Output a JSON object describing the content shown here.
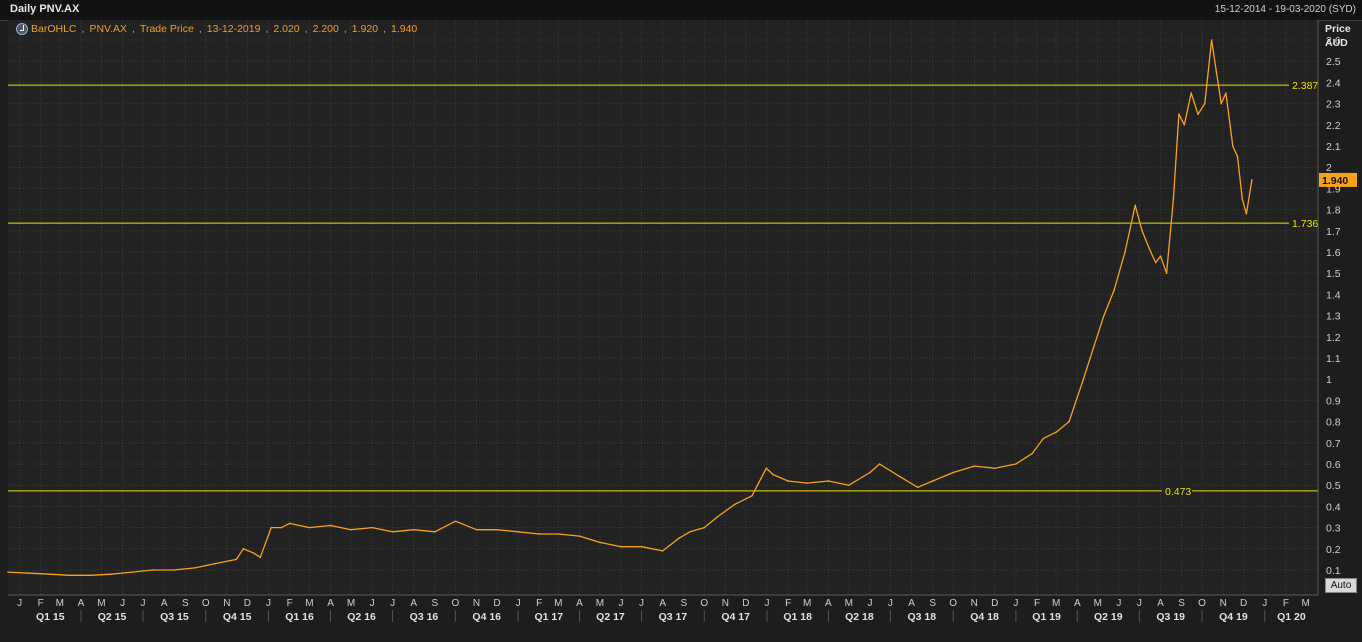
{
  "header": {
    "title": "Daily PNV.AX",
    "date_range": "15-12-2014 - 19-03-2020 (SYD)"
  },
  "legend": {
    "name": "BarOHLC",
    "ric": "PNV.AX",
    "field": "Trade Price",
    "date": "13-12-2019",
    "open": "2.020",
    "high": "2.200",
    "low": "1.920",
    "close": "1.940"
  },
  "axis": {
    "y_title": "Price",
    "y_unit": "AUD",
    "auto_label": "Auto"
  },
  "colors": {
    "background": "#1d1d1d",
    "plot_bg": "#222222",
    "grid": "#3c3c3c",
    "series": "#f7a21b",
    "hline": "#e8e000",
    "last_badge": "#f7a21b"
  },
  "chart_data": {
    "type": "line",
    "title": "Daily PNV.AX",
    "xlabel": "",
    "ylabel": "Price AUD",
    "ylim": [
      0,
      2.7
    ],
    "y_ticks": [
      "0.1",
      "0.2",
      "0.3",
      "0.4",
      "0.5",
      "0.6",
      "0.7",
      "0.8",
      "0.9",
      "1",
      "1.1",
      "1.2",
      "1.3",
      "1.4",
      "1.5",
      "1.6",
      "1.7",
      "1.8",
      "1.9",
      "2",
      "2.1",
      "2.2",
      "2.3",
      "2.4",
      "2.5",
      "2.6"
    ],
    "month_ticks": [
      "J",
      "F",
      "M",
      "A",
      "M",
      "J",
      "J",
      "A",
      "S",
      "O",
      "N",
      "D",
      "J",
      "F",
      "M",
      "A",
      "M",
      "J",
      "J",
      "A",
      "S",
      "O",
      "N",
      "D",
      "J",
      "F",
      "M",
      "A",
      "M",
      "J",
      "J",
      "A",
      "S",
      "O",
      "N",
      "D",
      "J",
      "F",
      "M",
      "A",
      "M",
      "J",
      "J",
      "A",
      "S",
      "O",
      "N",
      "D",
      "J",
      "F",
      "M",
      "A",
      "M",
      "J",
      "J",
      "A",
      "S",
      "O",
      "N",
      "D",
      "J",
      "F",
      "M"
    ],
    "quarter_ticks": [
      "Q1 15",
      "Q2 15",
      "Q3 15",
      "Q4 15",
      "Q1 16",
      "Q2 16",
      "Q3 16",
      "Q4 16",
      "Q1 17",
      "Q2 17",
      "Q3 17",
      "Q4 17",
      "Q1 18",
      "Q2 18",
      "Q3 18",
      "Q4 18",
      "Q1 19",
      "Q2 19",
      "Q3 19",
      "Q4 19",
      "Q1 20"
    ],
    "horizontal_lines": [
      {
        "value": 2.387,
        "label": "2.387"
      },
      {
        "value": 1.736,
        "label": "1.736"
      },
      {
        "value": 0.473,
        "label": "0.473"
      }
    ],
    "last_value": {
      "value": 1.94,
      "label": "1.940"
    },
    "series": [
      {
        "x": [
          "2014-12-15",
          "2015-01-15",
          "2015-02-15",
          "2015-03-15",
          "2015-04-15",
          "2015-05-15",
          "2015-06-15",
          "2015-07-15",
          "2015-08-15",
          "2015-09-15",
          "2015-10-15",
          "2015-11-15",
          "2015-11-25",
          "2015-12-10",
          "2015-12-20",
          "2016-01-05",
          "2016-01-20",
          "2016-02-01",
          "2016-03-01",
          "2016-04-01",
          "2016-05-01",
          "2016-06-01",
          "2016-07-01",
          "2016-08-01",
          "2016-09-01",
          "2016-10-01",
          "2016-11-01",
          "2016-12-01",
          "2017-01-01",
          "2017-02-01",
          "2017-03-01",
          "2017-04-01",
          "2017-05-01",
          "2017-06-01",
          "2017-07-01",
          "2017-08-01",
          "2017-08-25",
          "2017-09-10",
          "2017-10-01",
          "2017-10-20",
          "2017-11-15",
          "2017-12-10",
          "2017-12-31",
          "2018-01-10",
          "2018-02-01",
          "2018-03-01",
          "2018-04-01",
          "2018-05-01",
          "2018-06-01",
          "2018-06-15",
          "2018-07-15",
          "2018-08-10",
          "2018-09-01",
          "2018-10-01",
          "2018-11-01",
          "2018-12-01",
          "2019-01-01",
          "2019-01-25",
          "2019-02-10",
          "2019-03-01",
          "2019-03-20",
          "2019-04-10",
          "2019-04-25",
          "2019-05-10",
          "2019-05-25",
          "2019-06-10",
          "2019-06-25",
          "2019-07-05",
          "2019-07-15",
          "2019-07-25",
          "2019-08-01",
          "2019-08-10",
          "2019-08-20",
          "2019-08-28",
          "2019-09-05",
          "2019-09-15",
          "2019-09-25",
          "2019-10-05",
          "2019-10-15",
          "2019-10-22",
          "2019-10-29",
          "2019-11-05",
          "2019-11-15",
          "2019-11-22",
          "2019-11-29",
          "2019-12-05",
          "2019-12-13"
        ],
        "values": [
          0.09,
          0.085,
          0.08,
          0.075,
          0.075,
          0.08,
          0.09,
          0.1,
          0.1,
          0.11,
          0.13,
          0.15,
          0.2,
          0.18,
          0.16,
          0.3,
          0.3,
          0.32,
          0.3,
          0.31,
          0.29,
          0.3,
          0.28,
          0.29,
          0.28,
          0.33,
          0.29,
          0.29,
          0.28,
          0.27,
          0.27,
          0.26,
          0.23,
          0.21,
          0.21,
          0.19,
          0.25,
          0.28,
          0.3,
          0.35,
          0.41,
          0.45,
          0.58,
          0.55,
          0.52,
          0.51,
          0.52,
          0.5,
          0.56,
          0.6,
          0.54,
          0.49,
          0.52,
          0.56,
          0.59,
          0.58,
          0.6,
          0.65,
          0.72,
          0.75,
          0.8,
          1.0,
          1.15,
          1.3,
          1.42,
          1.6,
          1.82,
          1.7,
          1.62,
          1.55,
          1.58,
          1.5,
          1.85,
          2.25,
          2.2,
          2.35,
          2.25,
          2.3,
          2.6,
          2.45,
          2.3,
          2.35,
          2.1,
          2.05,
          1.85,
          1.78,
          1.94
        ]
      }
    ]
  }
}
